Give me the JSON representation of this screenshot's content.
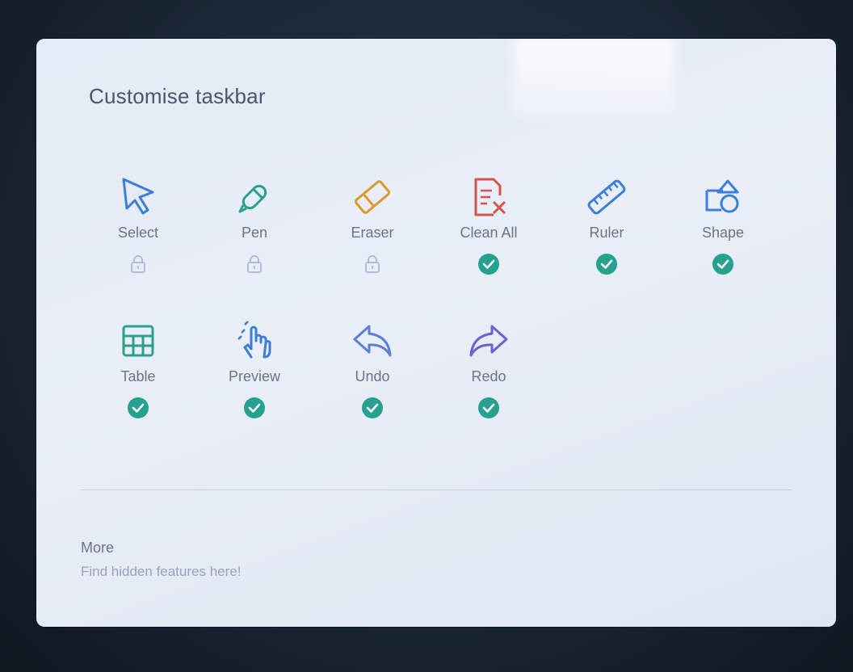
{
  "dialog": {
    "title": "Customise taskbar"
  },
  "tools": [
    {
      "label": "Select",
      "icon": "cursor-arrow-icon",
      "color": "#3b7fd9",
      "state": "locked"
    },
    {
      "label": "Pen",
      "icon": "pen-icon",
      "color": "#2aa08c",
      "state": "locked"
    },
    {
      "label": "Eraser",
      "icon": "eraser-icon",
      "color": "#d79a2b",
      "state": "locked"
    },
    {
      "label": "Clean All",
      "icon": "clean-all-icon",
      "color": "#d0554e",
      "state": "checked"
    },
    {
      "label": "Ruler",
      "icon": "ruler-icon",
      "color": "#3b7fd9",
      "state": "checked"
    },
    {
      "label": "Shape",
      "icon": "shape-icon",
      "color": "#3b7fd9",
      "state": "checked"
    },
    {
      "label": "Table",
      "icon": "table-icon",
      "color": "#2aa08c",
      "state": "checked"
    },
    {
      "label": "Preview",
      "icon": "preview-hand-icon",
      "color": "#3b7fd9",
      "state": "checked"
    },
    {
      "label": "Undo",
      "icon": "undo-icon",
      "color": "#5a7fd6",
      "state": "checked"
    },
    {
      "label": "Redo",
      "icon": "redo-icon",
      "color": "#6a63cf",
      "state": "checked"
    }
  ],
  "colors": {
    "check": "#26a08f",
    "lock": "#a9b8d6"
  },
  "more": {
    "title": "More",
    "subtitle": "Find hidden features here!"
  }
}
